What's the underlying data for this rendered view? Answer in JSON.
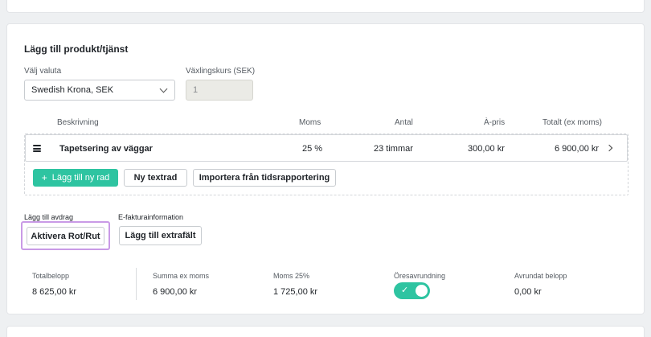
{
  "section": {
    "title": "Lägg till produkt/tjänst"
  },
  "currency": {
    "label": "Välj valuta",
    "value": "Swedish Krona, SEK"
  },
  "exchange": {
    "label": "Växlingskurs (SEK)",
    "value": "1"
  },
  "table": {
    "headers": {
      "description": "Beskrivning",
      "vat": "Moms",
      "quantity": "Antal",
      "unit_price": "À-pris",
      "total": "Totalt (ex moms)"
    },
    "rows": [
      {
        "description": "Tapetsering av väggar",
        "vat": "25 %",
        "quantity": "23 timmar",
        "unit_price": "300,00 kr",
        "total": "6 900,00 kr"
      }
    ]
  },
  "actions": {
    "add_row": "Lägg till ny rad",
    "new_text_row": "Ny textrad",
    "import_time": "Importera från tidsrapportering"
  },
  "deduction": {
    "label": "Lägg till avdrag",
    "button": "Aktivera Rot/Rut"
  },
  "einvoice": {
    "label": "E-fakturainformation",
    "button": "Lägg till extrafält"
  },
  "summary": {
    "total_label": "Totalbelopp",
    "total_value": "8 625,00 kr",
    "ex_vat_label": "Summa ex moms",
    "ex_vat_value": "6 900,00 kr",
    "vat_label": "Moms 25%",
    "vat_value": "1 725,00 kr",
    "rounding_label": "Öresavrundning",
    "rounding_on": true,
    "rounded_label": "Avrundat belopp",
    "rounded_value": "0,00 kr"
  },
  "colors": {
    "accent": "#2ec4a1",
    "highlight": "#c99ae6"
  },
  "icons": {
    "row_handle": "hamburger-icon",
    "row_expand": "chevron-right-icon",
    "currency_select": "chevron-down-icon",
    "toggle_check": "check-icon",
    "add": "plus-icon"
  }
}
